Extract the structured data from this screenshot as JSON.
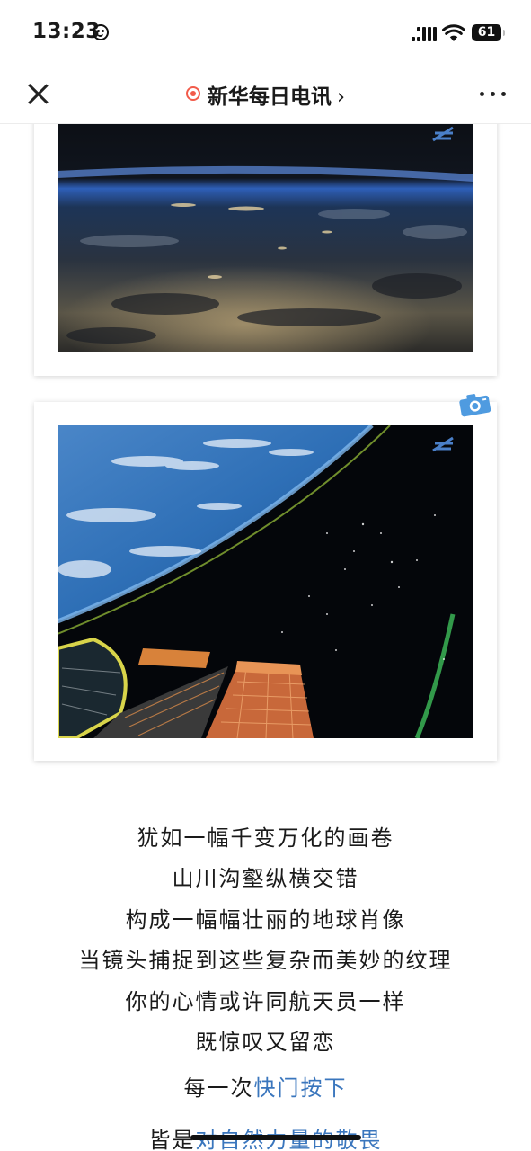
{
  "status_bar": {
    "time": "13:23",
    "battery": "61"
  },
  "nav": {
    "title": "新华每日电讯",
    "title_chevron": "›",
    "accent_color": "#f25b4a"
  },
  "photos": [
    {
      "logo_text": "CMS",
      "description_icon": "earth-night-photo"
    },
    {
      "logo_text": "CMS",
      "description_icon": "earth-limb-solar-panel-photo"
    }
  ],
  "poem": {
    "lines": [
      "犹如一幅千变万化的画卷",
      "山川沟壑纵横交错",
      "构成一幅幅壮丽的地球肖像",
      "当镜头捕捉到这些复杂而美妙的纹理",
      "你的心情或许同航天员一样",
      "既惊叹又留恋"
    ],
    "line7_plain": "每一次",
    "line7_highlight": "快门按下",
    "line8_plain": "皆是",
    "line8_highlight": "对自然力量的敬畏",
    "highlight_color": "#3a76bd"
  }
}
